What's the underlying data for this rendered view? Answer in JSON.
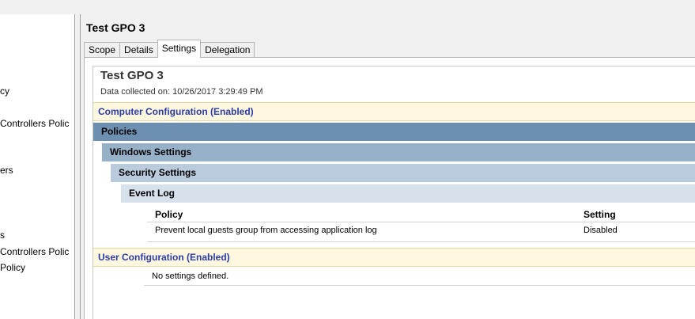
{
  "tree": {
    "items": [
      {
        "label": "cy"
      },
      {
        "label": "Controllers Polic"
      },
      {
        "label": "ers"
      },
      {
        "label": "s"
      },
      {
        "label": "Controllers Polic"
      },
      {
        "label": "Policy"
      }
    ]
  },
  "gpo": {
    "title": "Test GPO 3"
  },
  "tabs": [
    {
      "label": "Scope"
    },
    {
      "label": "Details"
    },
    {
      "label": "Settings"
    },
    {
      "label": "Delegation"
    }
  ],
  "report": {
    "title": "Test GPO 3",
    "date_line": "Data collected on: 10/26/2017 3:29:49 PM",
    "computer_config": "Computer Configuration (Enabled)",
    "levels": {
      "policies": "Policies",
      "windows_settings": "Windows Settings",
      "security_settings": "Security Settings",
      "event_log": "Event Log"
    },
    "table": {
      "col_policy": "Policy",
      "col_setting": "Setting",
      "rows": [
        {
          "policy": "Prevent local guests group from accessing application log",
          "setting": "Disabled"
        }
      ]
    },
    "user_config": "User Configuration (Enabled)",
    "user_none": "No settings defined."
  },
  "colors": {
    "config_band": "#fef8e0",
    "config_text": "#2a3ba4",
    "level1": "#6e90b0",
    "level2": "#97b1c9",
    "level3": "#b9cbdc",
    "level4": "#d6e1ec"
  }
}
